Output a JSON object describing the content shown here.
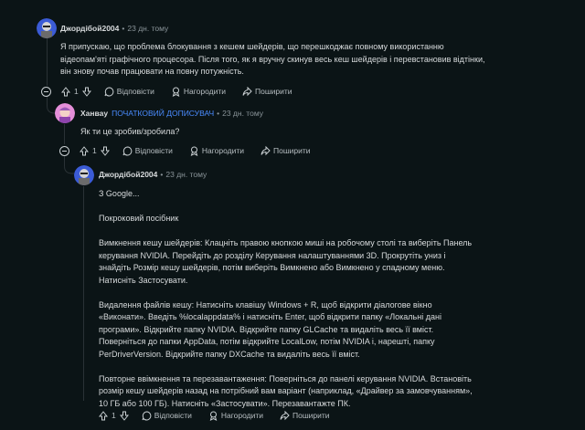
{
  "comments": [
    {
      "author": "Джордібой2004",
      "op_badge": "",
      "time": "23 дн. тому",
      "paragraphs": [
        "Я припускаю, що проблема блокування з кешем шейдерів, що перешкоджає повному використанню відеопам'яті графічного процесора. Після того, як я вручну скинув весь кеш шейдерів і перевстановив відтінки, він знову почав працювати на повну потужність."
      ],
      "votes": "1"
    },
    {
      "author": "Ханвау",
      "op_badge": "ПОЧАТКОВИЙ ДОПИСУВАЧ",
      "time": "23 дн. тому",
      "paragraphs": [
        "Як ти це зробив/зробила?"
      ],
      "votes": "1"
    },
    {
      "author": "Джордібой2004",
      "op_badge": "",
      "time": "23 дн. тому",
      "paragraphs": [
        "З Google...",
        "Покроковий посібник",
        "Вимкнення кешу шейдерів: Клацніть правою кнопкою миші на робочому столі та виберіть Панель керування NVIDIA. Перейдіть до розділу Керування налаштуваннями 3D. Прокрутіть униз і знайдіть Розмір кешу шейдерів, потім виберіть Вимкнено або Вимкнено у спадному меню. Натисніть Застосувати.",
        "Видалення файлів кешу: Натисніть клавішу Windows + R, щоб відкрити діалогове вікно «Виконати». Введіть %localappdata% і натисніть Enter, щоб відкрити папку «Локальні дані програми». Відкрийте папку NVIDIA. Відкрийте папку GLCache та видаліть весь її вміст. Поверніться до папки AppData, потім відкрийте LocalLow, потім NVIDIA і, нарешті, папку PerDriverVersion. Відкрийте папку DXCache та видаліть весь її вміст.",
        "Повторне ввімкнення та перезавантаження: Поверніться до панелі керування NVIDIA. Встановіть розмір кешу шейдерів назад на потрібний вам варіант (наприклад, «Драйвер за замовчуванням», 10 ГБ або 100 ГБ). Натисніть «Застосувати». Перезавантажте ПК."
      ],
      "votes": "1"
    }
  ],
  "actions": {
    "reply": "Відповісти",
    "award": "Нагородити",
    "share": "Поширити"
  }
}
